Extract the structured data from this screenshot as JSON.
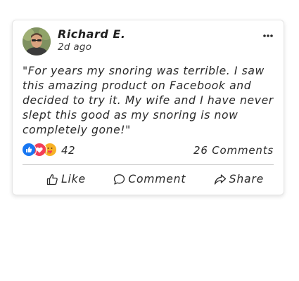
{
  "post": {
    "author_name": "Richard E.",
    "timestamp": "2d ago",
    "text": "\"For years my snoring was terrible. I saw this amazing product on Facebook and decided to try it. My wife and I have never slept this good as my snoring is now completely gone!\"",
    "reaction_icons": [
      "like-icon",
      "love-icon",
      "care-icon"
    ],
    "reaction_count": "42",
    "comments_label": "26 Comments"
  },
  "actions": {
    "like_label": "Like",
    "comment_label": "Comment",
    "share_label": "Share"
  },
  "colors": {
    "like": "#1877f2",
    "love": "#f33e58",
    "care": "#f7b125",
    "divider": "#c9c9c9"
  }
}
